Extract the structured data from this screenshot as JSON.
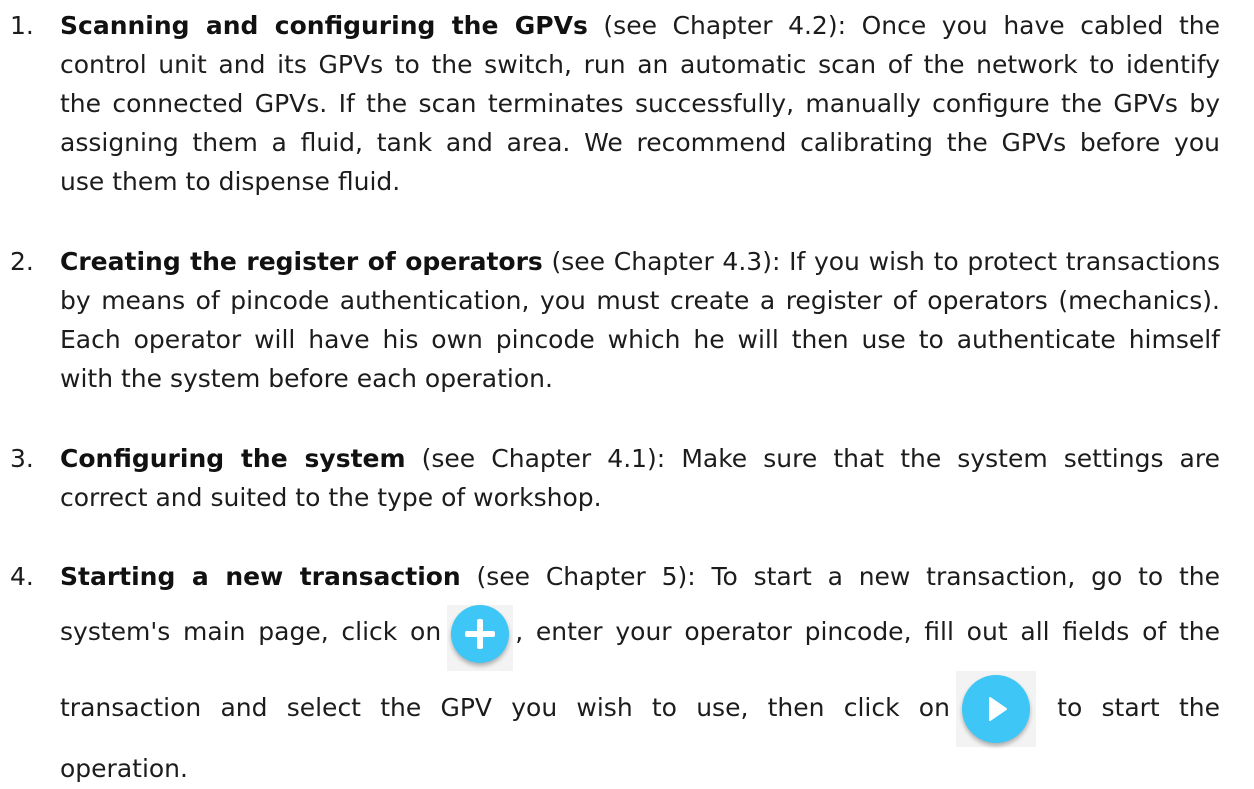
{
  "steps": [
    {
      "number": "1.",
      "lines": [
        {
          "strong": "Scanning and configuring the GPVs",
          "text": " (see Chapter 4.2): Once you have cabled the"
        },
        {
          "text": "control unit and its GPVs to the switch, run an automatic scan of the network to identify"
        },
        {
          "text": "the connected GPVs. If the scan terminates successfully, manually configure the GPVs by"
        },
        {
          "text": "assigning them a fluid, tank and area. We recommend calibrating the GPVs before you"
        },
        {
          "text": "use them to dispense fluid."
        }
      ]
    },
    {
      "number": "2.",
      "lines": [
        {
          "strong": "Creating the register of operators",
          "text": " (see Chapter 4.3): If you wish to protect transactions"
        },
        {
          "text": "by means of pincode authentication, you must create a register of operators (mechanics)."
        },
        {
          "text": "Each operator will have his own pincode which he will then use to authenticate himself"
        },
        {
          "text": "with the system before each operation."
        }
      ]
    },
    {
      "number": "3.",
      "lines": [
        {
          "strong": "Configuring the system",
          "text": " (see Chapter 4.1): Make sure that the system settings are"
        },
        {
          "text": "correct and suited to the type of workshop."
        }
      ]
    },
    {
      "number": "4.",
      "lines": [
        {
          "strong": "Starting a new transaction",
          "text": " (see Chapter 5): To start a new transaction, go to the"
        },
        {
          "text_before": "system's main page, click on",
          "icon": "plus-circle-icon",
          "text_after": ", enter your operator pincode, fill out all fields of the"
        },
        {
          "text_before": "transaction and select the GPV you wish to use, then click on",
          "icon": "play-circle-icon",
          "text_after": " to start the"
        },
        {
          "text": "operation."
        }
      ]
    }
  ],
  "colors": {
    "icon_circle": "#3ec6f6",
    "icon_glyph": "#ffffff",
    "text": "#1c1c1c"
  }
}
